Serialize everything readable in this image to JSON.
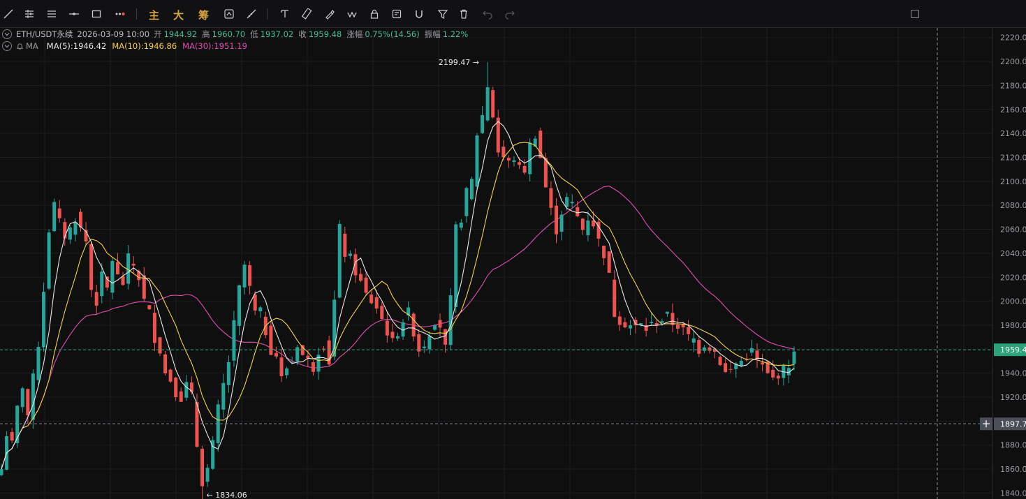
{
  "toolbar": {
    "main_label": "主",
    "big_label": "大",
    "chip_label": "筹"
  },
  "info": {
    "symbol": "ETH/USDT永续",
    "datetime": "2026-03-09 10:00",
    "open_label": "开",
    "open": "1944.92",
    "high_label": "高",
    "high": "1960.70",
    "low_label": "低",
    "low": "1937.02",
    "close_label": "收",
    "close": "1959.48",
    "change_label": "涨幅",
    "change": "0.75%(14.56)",
    "amp_label": "振幅",
    "amp": "1.22%",
    "ma_label": "MA",
    "ma5": "MA(5):1946.42",
    "ma10": "MA(10):1946.86",
    "ma30": "MA(30):1951.19"
  },
  "colors": {
    "up": "#26a69a",
    "down": "#ef5350",
    "ma5": "#e8e8e8",
    "ma10": "#f5d33f",
    "ma30": "#e04fb0",
    "last_price_bg": "#2aa37a",
    "crosshair_bg": "#4a4f57"
  },
  "chart_data": {
    "type": "candlestick",
    "y_ticks": [
      "2220.00",
      "2200.00",
      "2180.00",
      "2160.00",
      "2140.00",
      "2120.00",
      "2100.00",
      "2080.00",
      "2060.00",
      "2040.00",
      "2020.00",
      "2000.00",
      "1980.00",
      "1960.00",
      "1940.00",
      "1920.00",
      "1900.00",
      "1880.00",
      "1860.00",
      "1840.00"
    ],
    "ylim": [
      1835,
      2228
    ],
    "last_price_label": "1959.4",
    "last_price": 1959.48,
    "crosshair_label": "1897.7",
    "crosshair_price": 1897.7,
    "max_label": "2199.47",
    "max_value": 2199.47,
    "min_label": "1834.06",
    "min_value": 1834.06,
    "close_path": [
      1860,
      1890,
      1880,
      1910,
      1930,
      1905,
      1935,
      1965,
      2010,
      2060,
      2080,
      2065,
      2055,
      2060,
      2070,
      2060,
      2050,
      2010,
      2000,
      2020,
      2010,
      2035,
      2020,
      2015,
      2035,
      2030,
      2020,
      2000,
      1990,
      1970,
      1960,
      1940,
      1935,
      1925,
      1920,
      1930,
      1920,
      1880,
      1850,
      1860,
      1880,
      1910,
      1930,
      1950,
      1980,
      2010,
      2030,
      2010,
      1990,
      1990,
      1975,
      1960,
      1955,
      1935,
      1945,
      1950,
      1965,
      1955,
      1950,
      1945,
      1960,
      1965,
      1950,
      2000,
      2060,
      2040,
      2035,
      2025,
      2015,
      2005,
      2000,
      1995,
      1985,
      1975,
      1965,
      1975,
      1985,
      1990,
      1975,
      1960,
      1965,
      1975,
      1985,
      1980,
      1960,
      2000,
      2060,
      2070,
      2090,
      2100,
      2140,
      2155,
      2180,
      2155,
      2125,
      2120,
      2115,
      2120,
      2110,
      2110,
      2130,
      2140,
      2120,
      2095,
      2075,
      2060,
      2075,
      2085,
      2080,
      2070,
      2060,
      2070,
      2065,
      2050,
      2040,
      2020,
      1990,
      1985,
      1982,
      1980,
      1978,
      1980,
      1977,
      1980,
      1983,
      1985,
      1987,
      1982,
      1980,
      1975,
      1970,
      1968,
      1960,
      1965,
      1962,
      1958,
      1950,
      1940,
      1942,
      1948,
      1950,
      1955,
      1958,
      1950,
      1945,
      1938,
      1935,
      1940,
      1942,
      1948,
      1955
    ]
  }
}
